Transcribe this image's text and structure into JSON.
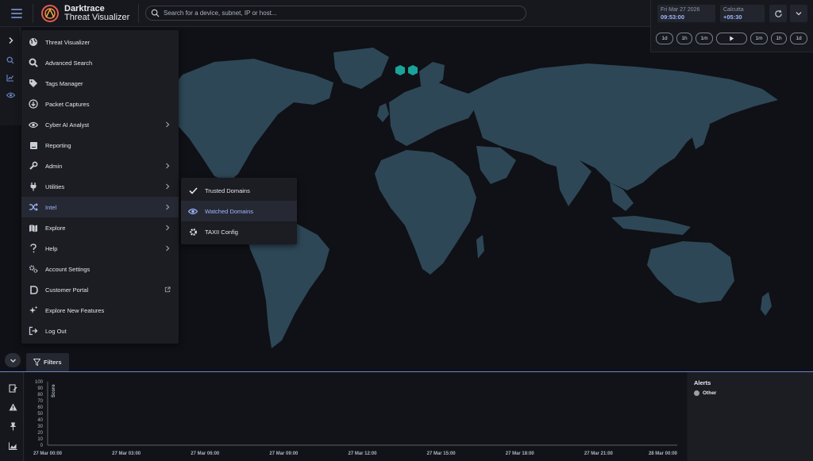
{
  "header": {
    "brand_name": "Darktrace",
    "brand_product": "Threat Visualizer",
    "search_placeholder": "Search for a device, subnet, IP or host..."
  },
  "time_panel": {
    "date": "Fri Mar 27 2026",
    "time": "09:53:00",
    "timezone_name": "Calcutta",
    "timezone_offset": "+05:30",
    "rewind_buttons": [
      "1d",
      "1h",
      "1m"
    ],
    "forward_buttons": [
      "1m",
      "1h",
      "1d"
    ]
  },
  "menu": {
    "items": [
      {
        "label": "Threat Visualizer",
        "icon": "globe-icon",
        "submenu": false
      },
      {
        "label": "Advanced Search",
        "icon": "search-icon",
        "submenu": false
      },
      {
        "label": "Tags Manager",
        "icon": "tag-icon",
        "submenu": false
      },
      {
        "label": "Packet Captures",
        "icon": "download-icon",
        "submenu": false
      },
      {
        "label": "Cyber AI Analyst",
        "icon": "eye-icon",
        "submenu": true
      },
      {
        "label": "Reporting",
        "icon": "report-icon",
        "submenu": false
      },
      {
        "label": "Admin",
        "icon": "wrench-icon",
        "submenu": true
      },
      {
        "label": "Utilities",
        "icon": "plug-icon",
        "submenu": true
      },
      {
        "label": "Intel",
        "icon": "shuffle-icon",
        "submenu": true,
        "active": true
      },
      {
        "label": "Explore",
        "icon": "map-icon",
        "submenu": true
      },
      {
        "label": "Help",
        "icon": "question-icon",
        "submenu": true
      },
      {
        "label": "Account Settings",
        "icon": "gears-icon",
        "submenu": false
      },
      {
        "label": "Customer Portal",
        "icon": "portal-icon",
        "submenu": false,
        "external": true
      },
      {
        "label": "Explore New Features",
        "icon": "sparkle-icon",
        "submenu": false
      },
      {
        "label": "Log Out",
        "icon": "logout-icon",
        "submenu": false
      }
    ]
  },
  "intel_submenu": {
    "items": [
      {
        "label": "Trusted Domains",
        "icon": "check-icon"
      },
      {
        "label": "Watched Domains",
        "icon": "eye-icon",
        "active": true
      },
      {
        "label": "TAXII Config",
        "icon": "gear-icon"
      }
    ]
  },
  "filters": {
    "label": "Filters"
  },
  "alerts_panel": {
    "title": "Alerts",
    "legend": [
      {
        "name": "Other",
        "color": "#9aa0aa"
      }
    ]
  },
  "colors": {
    "accent": "#9eb7ff",
    "map_land": "#2e4757",
    "map_marker": "#1aa39a",
    "background": "#0f1116"
  },
  "chart_data": {
    "type": "line",
    "ylabel": "Score",
    "ylim": [
      0,
      100
    ],
    "yticks": [
      100,
      90,
      80,
      70,
      60,
      50,
      40,
      30,
      20,
      10,
      0
    ],
    "xticks": [
      "27 Mar 00:00",
      "27 Mar 03:00",
      "27 Mar 06:00",
      "27 Mar 09:00",
      "27 Mar 12:00",
      "27 Mar 15:00",
      "27 Mar 18:00",
      "27 Mar 21:00",
      "28 Mar 00:00"
    ],
    "series": []
  }
}
